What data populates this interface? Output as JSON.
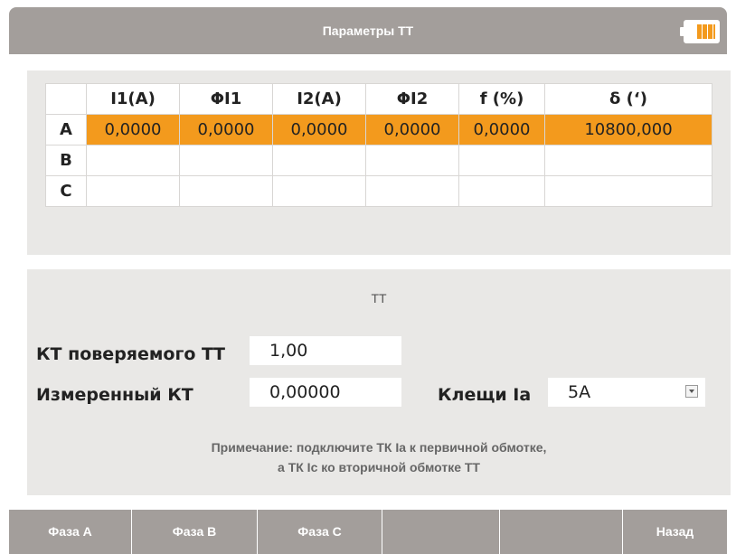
{
  "header": {
    "title": "Параметры ТТ",
    "battery_icon": "battery-icon",
    "battery_color": "#f39a1d"
  },
  "table": {
    "columns": [
      "",
      "I1(A)",
      "ΦI1",
      "I2(A)",
      "ΦI2",
      "f (%)",
      "δ (‘)"
    ],
    "rows": [
      {
        "phase": "A",
        "cells": [
          "0,0000",
          "0,0000",
          "0,0000",
          "0,0000",
          "0,0000",
          "10800,000"
        ]
      },
      {
        "phase": "B",
        "cells": [
          "",
          "",
          "",
          "",
          "",
          ""
        ]
      },
      {
        "phase": "C",
        "cells": [
          "",
          "",
          "",
          "",
          "",
          ""
        ]
      }
    ],
    "highlight_color": "#f39a1d"
  },
  "tt": {
    "section_title": "ТТ",
    "kt_label": "КТ поверяемого ТТ",
    "kt_value": "1,00",
    "measured_label": "Измеренный КТ",
    "measured_value": "0,00000",
    "clamp_label": "Клещи Ia",
    "clamp_value": "5A",
    "note_line1": "Примечание: подключите ТК Ia к первичной обмотке,",
    "note_line2": "а ТК Ic ко вторичной обмотке ТТ"
  },
  "footer": {
    "buttons": [
      "Фаза А",
      "Фаза В",
      "Фаза С",
      "",
      "",
      "Назад"
    ]
  },
  "colors": {
    "bar": "#a39e9b",
    "panel": "#e9e8e6",
    "accent": "#f39a1d"
  }
}
